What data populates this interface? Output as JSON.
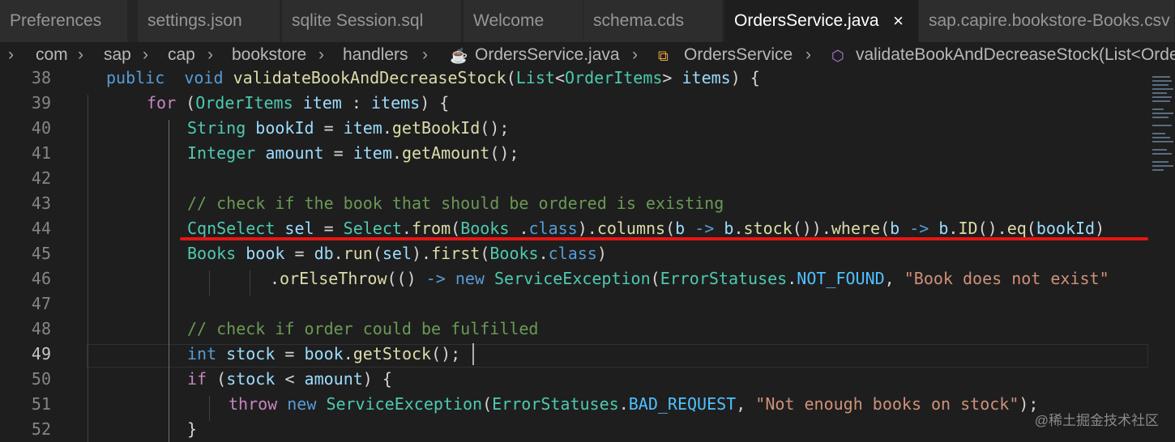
{
  "tabs": [
    {
      "label": "Preferences"
    },
    {
      "label": "settings.json"
    },
    {
      "label": "sqlite Session.sql"
    },
    {
      "label": "Welcome"
    },
    {
      "label": "schema.cds"
    },
    {
      "label": "OrdersService.java",
      "active": true,
      "close": "×"
    },
    {
      "label": "sap.capire.bookstore-Books.csv"
    }
  ],
  "breadcrumb": {
    "items": [
      "com",
      "sap",
      "cap",
      "bookstore",
      "handlers",
      "OrdersService.java",
      "OrdersService",
      "validateBookAndDecreaseStock(List<OrderItems> items)"
    ],
    "separator": "›",
    "icons": {
      "file": "java-file-icon",
      "class": "class-icon",
      "method": "method-icon"
    }
  },
  "editor": {
    "current_line": "49",
    "lines": [
      {
        "n": "38",
        "parts": [
          [
            "kw",
            "public"
          ],
          [
            "",
            "  "
          ],
          [
            "kw",
            "void"
          ],
          [
            "",
            " "
          ],
          [
            "fn",
            "validateBookAndDecreaseStock"
          ],
          [
            "",
            "("
          ],
          [
            "ty",
            "List"
          ],
          [
            "",
            "<"
          ],
          [
            "ty",
            "OrderItems"
          ],
          [
            "",
            "> "
          ],
          [
            "var",
            "items"
          ],
          [
            "",
            ") {"
          ]
        ]
      },
      {
        "n": "39",
        "parts": [
          [
            "ctl",
            "for"
          ],
          [
            "",
            " ("
          ],
          [
            "ty",
            "OrderItems"
          ],
          [
            "",
            " "
          ],
          [
            "var",
            "item"
          ],
          [
            "",
            " : "
          ],
          [
            "var",
            "items"
          ],
          [
            "",
            ") {"
          ]
        ]
      },
      {
        "n": "40",
        "parts": [
          [
            "ty",
            "String"
          ],
          [
            "",
            " "
          ],
          [
            "var",
            "bookId"
          ],
          [
            "",
            " = "
          ],
          [
            "var",
            "item"
          ],
          [
            "",
            "."
          ],
          [
            "fn",
            "getBookId"
          ],
          [
            "",
            "();"
          ]
        ]
      },
      {
        "n": "41",
        "parts": [
          [
            "ty",
            "Integer"
          ],
          [
            "",
            " "
          ],
          [
            "var",
            "amount"
          ],
          [
            "",
            " = "
          ],
          [
            "var",
            "item"
          ],
          [
            "",
            "."
          ],
          [
            "fn",
            "getAmount"
          ],
          [
            "",
            "();"
          ]
        ]
      },
      {
        "n": "42",
        "parts": []
      },
      {
        "n": "43",
        "parts": [
          [
            "cm",
            "// check if the book that should be ordered is existing"
          ]
        ]
      },
      {
        "n": "44",
        "parts": [
          [
            "ty",
            "CqnSelect"
          ],
          [
            "",
            " "
          ],
          [
            "var",
            "sel"
          ],
          [
            "",
            " = "
          ],
          [
            "ty",
            "Select"
          ],
          [
            "",
            "."
          ],
          [
            "fn",
            "from"
          ],
          [
            "",
            "("
          ],
          [
            "ty",
            "Books"
          ],
          [
            "",
            " ."
          ],
          [
            "kw",
            "class"
          ],
          [
            "",
            ")."
          ],
          [
            "fn",
            "columns"
          ],
          [
            "",
            "("
          ],
          [
            "var",
            "b"
          ],
          [
            "",
            " "
          ],
          [
            "kw",
            "->"
          ],
          [
            "",
            " "
          ],
          [
            "var",
            "b"
          ],
          [
            "",
            "."
          ],
          [
            "fn",
            "stock"
          ],
          [
            "",
            "())."
          ],
          [
            "fn",
            "where"
          ],
          [
            "",
            "("
          ],
          [
            "var",
            "b"
          ],
          [
            "",
            " "
          ],
          [
            "kw",
            "->"
          ],
          [
            "",
            " "
          ],
          [
            "var",
            "b"
          ],
          [
            "",
            "."
          ],
          [
            "fn",
            "ID"
          ],
          [
            "",
            "()."
          ],
          [
            "fn",
            "eq"
          ],
          [
            "",
            "("
          ],
          [
            "var",
            "bookId"
          ],
          [
            "",
            ")"
          ]
        ]
      },
      {
        "n": "45",
        "parts": [
          [
            "ty",
            "Books"
          ],
          [
            "",
            " "
          ],
          [
            "var",
            "book"
          ],
          [
            "",
            " = "
          ],
          [
            "var",
            "db"
          ],
          [
            "",
            "."
          ],
          [
            "fn",
            "run"
          ],
          [
            "",
            "("
          ],
          [
            "var",
            "sel"
          ],
          [
            "",
            ")."
          ],
          [
            "fn",
            "first"
          ],
          [
            "",
            "("
          ],
          [
            "ty",
            "Books"
          ],
          [
            "",
            "."
          ],
          [
            "kw",
            "class"
          ],
          [
            "",
            ")"
          ]
        ]
      },
      {
        "n": "46",
        "parts": [
          [
            "",
            "."
          ],
          [
            "fn",
            "orElseThrow"
          ],
          [
            "",
            "(() "
          ],
          [
            "kw",
            "->"
          ],
          [
            "",
            " "
          ],
          [
            "kw",
            "new"
          ],
          [
            "",
            " "
          ],
          [
            "ty",
            "ServiceException"
          ],
          [
            "",
            "("
          ],
          [
            "ty",
            "ErrorStatuses"
          ],
          [
            "",
            "."
          ],
          [
            "cst",
            "NOT_FOUND"
          ],
          [
            "",
            ", "
          ],
          [
            "str",
            "\"Book does not exist\""
          ]
        ]
      },
      {
        "n": "47",
        "parts": []
      },
      {
        "n": "48",
        "parts": [
          [
            "cm",
            "// check if order could be fulfilled"
          ]
        ]
      },
      {
        "n": "49",
        "parts": [
          [
            "kw",
            "int"
          ],
          [
            "",
            " "
          ],
          [
            "var",
            "stock"
          ],
          [
            "",
            " = "
          ],
          [
            "var",
            "book"
          ],
          [
            "",
            "."
          ],
          [
            "fn",
            "getStock"
          ],
          [
            "",
            "();"
          ]
        ]
      },
      {
        "n": "50",
        "parts": [
          [
            "ctl",
            "if"
          ],
          [
            "",
            " ("
          ],
          [
            "var",
            "stock"
          ],
          [
            "",
            " < "
          ],
          [
            "var",
            "amount"
          ],
          [
            "",
            ") {"
          ]
        ]
      },
      {
        "n": "51",
        "parts": [
          [
            "ctl",
            "throw"
          ],
          [
            "",
            " "
          ],
          [
            "kw",
            "new"
          ],
          [
            "",
            " "
          ],
          [
            "ty",
            "ServiceException"
          ],
          [
            "",
            "("
          ],
          [
            "ty",
            "ErrorStatuses"
          ],
          [
            "",
            "."
          ],
          [
            "cst",
            "BAD_REQUEST"
          ],
          [
            "",
            ", "
          ],
          [
            "str",
            "\"Not enough books on stock\""
          ],
          [
            "",
            ");"
          ]
        ]
      },
      {
        "n": "52",
        "parts": [
          [
            "",
            "}"
          ]
        ]
      }
    ]
  },
  "watermark": "@稀土掘金技术社区"
}
